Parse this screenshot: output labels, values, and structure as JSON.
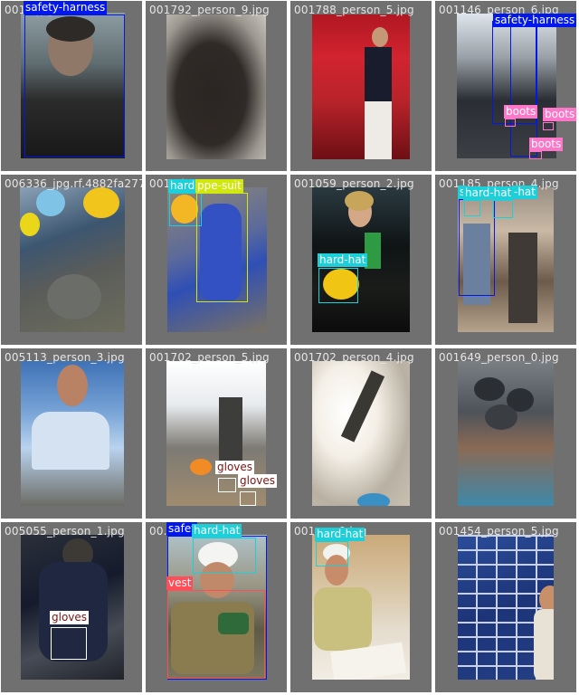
{
  "colors": {
    "safety-harness": "#0018ec",
    "boots": "#ff77c9",
    "hard-hat": "#1ccfd9",
    "ppe-suit": "#d0e80f",
    "gloves": "#ffffff",
    "vest": "#ff4d5a"
  },
  "cells": [
    {
      "filename": "001...jpg",
      "labels": [
        "safety-harness"
      ]
    },
    {
      "filename": "001792_person_9.jpg",
      "labels": []
    },
    {
      "filename": "001788_person_5.jpg",
      "labels": []
    },
    {
      "filename": "001146_person_6.jpg",
      "labels": [
        "safety-harness",
        "boots",
        "boots",
        "boots"
      ]
    },
    {
      "filename": "006336_jpg.rf.4882fa277f06...jpg",
      "labels": []
    },
    {
      "filename": "001...jpg",
      "labels": [
        "hard",
        "ppe-suit"
      ]
    },
    {
      "filename": "001059_person_2.jpg",
      "labels": [
        "hard-hat"
      ]
    },
    {
      "filename": "001185_person_4.jpg",
      "labels": [
        "s",
        "hard-hat",
        "-hat"
      ]
    },
    {
      "filename": "005113_person_3.jpg",
      "labels": []
    },
    {
      "filename": "001702_person_5.jpg",
      "labels": [
        "gloves",
        "gloves"
      ]
    },
    {
      "filename": "001702_person_4.jpg",
      "labels": []
    },
    {
      "filename": "001649_person_0.jpg",
      "labels": []
    },
    {
      "filename": "005055_person_1.jpg",
      "labels": [
        "gloves"
      ]
    },
    {
      "filename": "00...s",
      "labels": [
        "safet",
        "hard-hat",
        "vest"
      ]
    },
    {
      "filename": "001...n_0.jpg",
      "labels": [
        "hard-hat"
      ]
    },
    {
      "filename": "001454_person_5.jpg",
      "labels": []
    }
  ]
}
